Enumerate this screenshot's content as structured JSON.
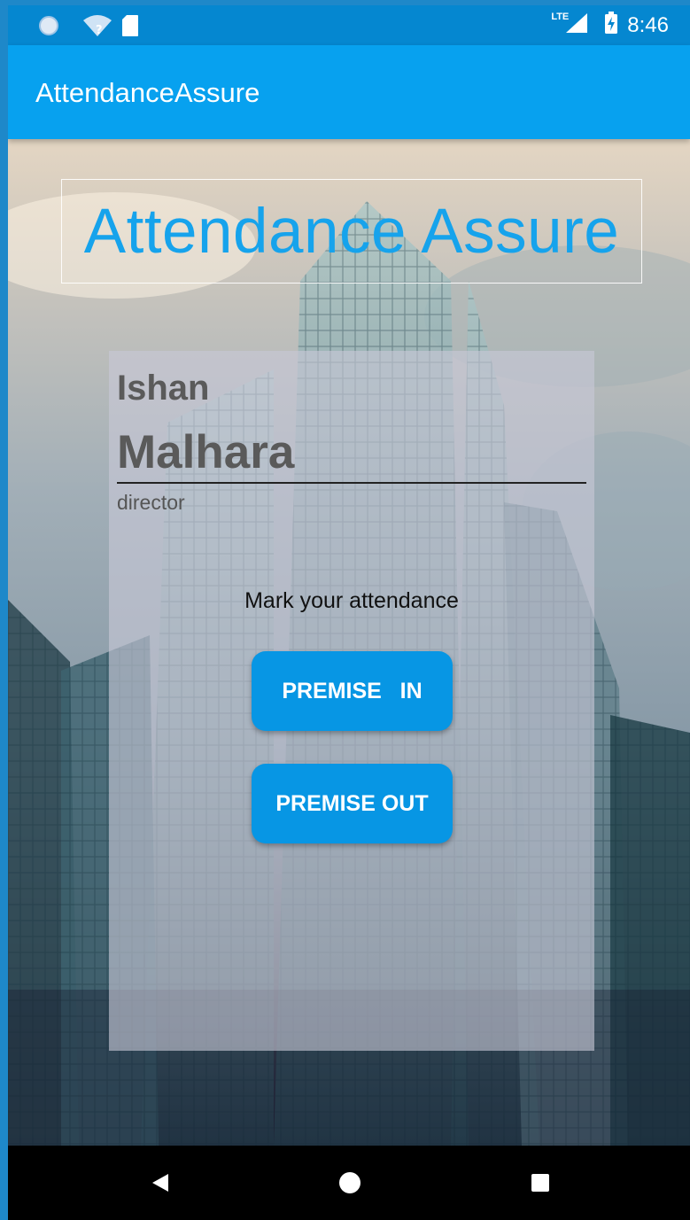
{
  "status_bar": {
    "time": "8:46",
    "network_label": "LTE",
    "icons": [
      "circle-status-icon",
      "wifi-unknown-icon",
      "sd-card-icon",
      "signal-icon",
      "battery-charging-icon"
    ]
  },
  "app_bar": {
    "title": "AttendanceAssure"
  },
  "content": {
    "banner_title": "Attendance Assure",
    "user": {
      "first_name": "Ishan",
      "last_name": "Malhara",
      "role": "director"
    },
    "mark_label": "Mark your attendance",
    "premise_in_label": "PREMISE   IN",
    "premise_out_label": "PREMISE OUT"
  },
  "colors": {
    "status_bar": "#0587d0",
    "app_bar": "#07a1ef",
    "accent": "#16a3ec",
    "button": "#0796e4"
  },
  "nav_bar": {
    "buttons": [
      "back-icon",
      "home-icon",
      "recents-icon"
    ]
  }
}
